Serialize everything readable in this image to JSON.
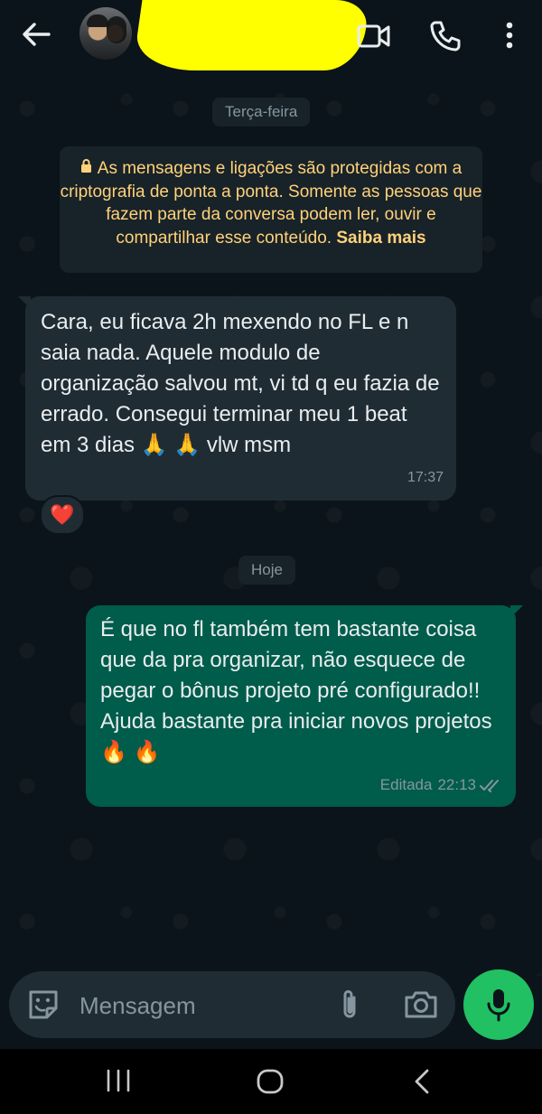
{
  "chat": {
    "date_divider_1": "Terça-feira",
    "encryption_notice": "As mensagens e ligações são protegidas com a criptografia de ponta a ponta. Somente as pessoas que fazem parte da conversa podem ler, ouvir e compartilhar esse conteúdo.",
    "encryption_link": "Saiba mais",
    "incoming_message": {
      "text": "Cara, eu ficava 2h mexendo no FL e n saia nada. Aquele modulo de organização salvou mt, vi td q eu fazia de errado. Consegui terminar meu 1 beat em 3 dias 🙏 🙏 vlw msm",
      "time": "17:37",
      "reaction": "❤️"
    },
    "date_divider_2": "Hoje",
    "outgoing_message": {
      "text": "É que no fl também tem bastante coisa que da pra organizar, não esquece de pegar o bônus projeto pré configurado!! Ajuda bastante pra iniciar novos projetos 🔥 🔥",
      "edited_label": "Editada",
      "time": "22:13",
      "status": "read"
    }
  },
  "composer": {
    "placeholder": "Mensagem"
  },
  "icons": {
    "header": [
      "arrow-left-icon",
      "video-call-icon",
      "phone-icon",
      "more-vertical-icon"
    ],
    "composer": [
      "sticker-icon",
      "paperclip-icon",
      "camera-icon",
      "mic-icon"
    ],
    "navbar": [
      "recents-icon",
      "home-icon",
      "back-chevron-icon"
    ]
  },
  "colors": {
    "background": "#0b141a",
    "incoming_bubble": "#202c33",
    "outgoing_bubble": "#005c4b",
    "mic_button": "#21c063",
    "encryption_text": "#ffd279",
    "redaction": "#ffff00"
  }
}
